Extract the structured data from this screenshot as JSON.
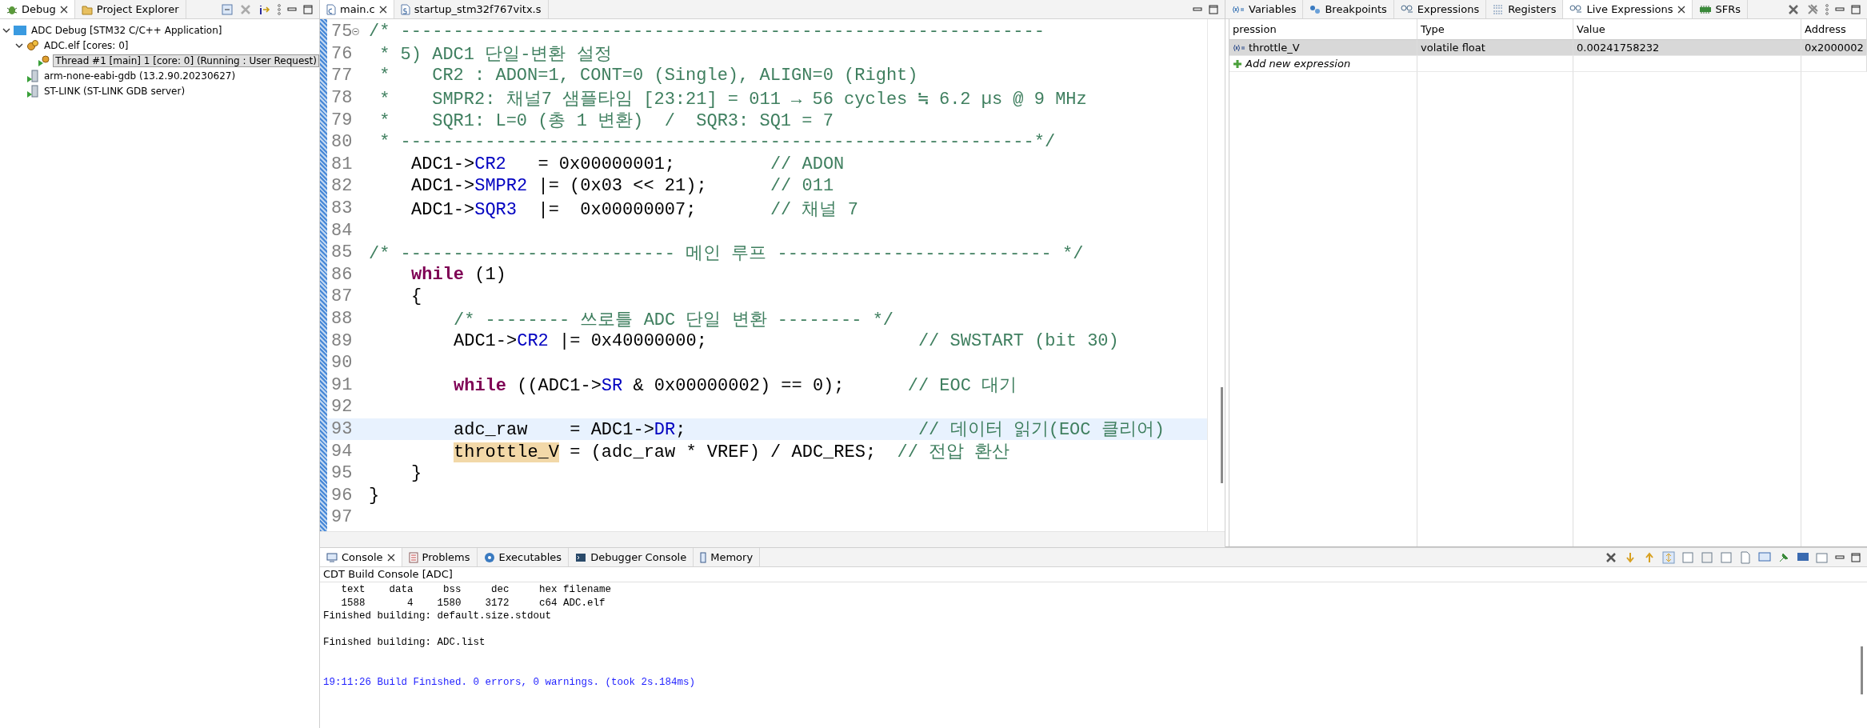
{
  "debug_view": {
    "tabs": [
      {
        "label": "Debug",
        "selected": true,
        "kind": "debug"
      },
      {
        "label": "Project Explorer",
        "selected": false,
        "kind": "project"
      }
    ],
    "tree": [
      {
        "label": "ADC Debug [STM32 C/C++ Application]",
        "kind": "launch",
        "selected": false,
        "expanded": true,
        "children": [
          {
            "label": "ADC.elf [cores: 0]",
            "kind": "process",
            "selected": false,
            "expanded": true,
            "children": [
              {
                "label": "Thread #1 [main] 1 [core: 0] (Running : User Request)",
                "kind": "thread",
                "selected": true
              }
            ]
          },
          {
            "label": "arm-none-eabi-gdb (13.2.90.20230627)",
            "kind": "server",
            "selected": false
          },
          {
            "label": "ST-LINK (ST-LINK GDB server)",
            "kind": "server",
            "selected": false
          }
        ]
      }
    ]
  },
  "editor": {
    "tabs": [
      {
        "label": "main.c",
        "selected": true,
        "kind": "c"
      },
      {
        "label": "startup_stm32f767vitx.s",
        "selected": false,
        "kind": "s"
      }
    ],
    "lines": [
      {
        "number": "75",
        "folded_marker": true,
        "current": false,
        "tokens": [
          {
            "kind": "comment",
            "text": "/* -------------------------------------------------------------"
          }
        ]
      },
      {
        "number": "76",
        "current": false,
        "tokens": [
          {
            "kind": "comment",
            "text": " * 5) ADC1 단일-변환 설정"
          }
        ]
      },
      {
        "number": "77",
        "current": false,
        "tokens": [
          {
            "kind": "comment",
            "text": " *    CR2 : ADON=1, CONT=0 (Single), ALIGN=0 (Right)"
          }
        ]
      },
      {
        "number": "78",
        "current": false,
        "tokens": [
          {
            "kind": "comment",
            "text": " *    SMPR2: 채널7 샘플타임 [23:21] = 011 → 56 cycles ≒ 6.2 µs @ 9 MHz"
          }
        ]
      },
      {
        "number": "79",
        "current": false,
        "tokens": [
          {
            "kind": "comment",
            "text": " *    SQR1: L=0 (총 1 변환)  /  SQR3: SQ1 = 7"
          }
        ]
      },
      {
        "number": "80",
        "current": false,
        "tokens": [
          {
            "kind": "comment",
            "text": " * ------------------------------------------------------------*/"
          }
        ]
      },
      {
        "number": "81",
        "current": false,
        "kind": "nested",
        "tokens": [
          {
            "kind": "plain",
            "text": "ADC1->"
          },
          {
            "kind": "field",
            "text": "CR2"
          },
          {
            "kind": "plain",
            "text": "   = 0x00000001;         "
          },
          {
            "kind": "comment",
            "text": "// ADON"
          }
        ]
      },
      {
        "number": "82",
        "current": false,
        "kind": "nested",
        "tokens": [
          {
            "kind": "plain",
            "text": "ADC1->"
          },
          {
            "kind": "field",
            "text": "SMPR2"
          },
          {
            "kind": "plain",
            "text": " |= (0x03 << 21);      "
          },
          {
            "kind": "comment",
            "text": "// 011"
          }
        ]
      },
      {
        "number": "83",
        "current": false,
        "kind": "nested",
        "tokens": [
          {
            "kind": "plain",
            "text": "ADC1->"
          },
          {
            "kind": "field",
            "text": "SQR3"
          },
          {
            "kind": "plain",
            "text": "  |=  0x00000007;       "
          },
          {
            "kind": "comment",
            "text": "// 채널 7"
          }
        ]
      },
      {
        "number": "84",
        "current": false
      },
      {
        "number": "85",
        "current": false,
        "tokens": [
          {
            "kind": "comment",
            "text": "/* -------------------------- 메인 루프 -------------------------- */"
          }
        ]
      },
      {
        "number": "86",
        "current": false,
        "kind": "nested",
        "tokens": [
          {
            "kind": "keyword",
            "text": "while"
          },
          {
            "kind": "plain",
            "text": " (1)"
          }
        ]
      },
      {
        "number": "87",
        "current": false,
        "kind": "nested",
        "tokens": [
          {
            "kind": "plain",
            "text": "{"
          }
        ]
      },
      {
        "number": "88",
        "current": false,
        "kind": "deep",
        "tokens": [
          {
            "kind": "comment",
            "text": "/* -------- 쓰로틀 ADC 단일 변환 -------- */"
          }
        ]
      },
      {
        "number": "89",
        "current": false,
        "kind": "deep",
        "tokens": [
          {
            "kind": "plain",
            "text": "ADC1->"
          },
          {
            "kind": "field",
            "text": "CR2"
          },
          {
            "kind": "plain",
            "text": " |= 0x40000000;                    "
          },
          {
            "kind": "comment",
            "text": "// SWSTART (bit 30)"
          }
        ]
      },
      {
        "number": "90",
        "current": false
      },
      {
        "number": "91",
        "current": false,
        "kind": "deep",
        "tokens": [
          {
            "kind": "keyword",
            "text": "while"
          },
          {
            "kind": "plain",
            "text": " ((ADC1->"
          },
          {
            "kind": "field",
            "text": "SR"
          },
          {
            "kind": "plain",
            "text": " & 0x00000002) == 0);      "
          },
          {
            "kind": "comment",
            "text": "// EOC 대기"
          }
        ]
      },
      {
        "number": "92",
        "current": false
      },
      {
        "number": "93",
        "current": true,
        "kind": "deep",
        "tokens": [
          {
            "kind": "plain",
            "text": "adc_raw    = ADC1->"
          },
          {
            "kind": "field",
            "text": "DR"
          },
          {
            "kind": "plain",
            "text": ";                      "
          },
          {
            "kind": "comment",
            "text": "// 데이터 읽기(EOC 클리어)"
          }
        ]
      },
      {
        "number": "94",
        "current": false,
        "kind": "deep",
        "tokens": [
          {
            "kind": "occurrence",
            "text": "throttle_V"
          },
          {
            "kind": "plain",
            "text": " = (adc_raw * VREF) / ADC_RES;  "
          },
          {
            "kind": "comment",
            "text": "// 전압 환산"
          }
        ]
      },
      {
        "number": "95",
        "current": false,
        "kind": "nested",
        "tokens": [
          {
            "kind": "plain",
            "text": "}"
          }
        ]
      },
      {
        "number": "96",
        "current": false,
        "tokens": [
          {
            "kind": "plain",
            "text": "}"
          }
        ]
      },
      {
        "number": "97",
        "current": false
      }
    ]
  },
  "expressions_view": {
    "tabs": [
      {
        "label": "Variables",
        "selected": false,
        "kind": "variables"
      },
      {
        "label": "Breakpoints",
        "selected": false,
        "kind": "breakpoints"
      },
      {
        "label": "Expressions",
        "selected": false,
        "kind": "expressions"
      },
      {
        "label": "Registers",
        "selected": false,
        "kind": "registers"
      },
      {
        "label": "Live Expressions",
        "selected": true,
        "kind": "expressions"
      },
      {
        "label": "SFRs",
        "selected": false,
        "kind": "sfrs"
      }
    ],
    "columns": [
      "pression",
      "Type",
      "Value",
      "Address"
    ],
    "rows": [
      {
        "cells": [
          "throttle_V",
          "volatile float",
          "0.00241758232",
          "0x2000002"
        ],
        "selected": true
      }
    ],
    "add_row": "Add new expression"
  },
  "console_view": {
    "tabs": [
      {
        "label": "Console",
        "selected": true,
        "kind": "console"
      },
      {
        "label": "Problems",
        "selected": false,
        "kind": "problems"
      },
      {
        "label": "Executables",
        "selected": false,
        "kind": "executables"
      },
      {
        "label": "Debugger Console",
        "selected": false,
        "kind": "debugger"
      },
      {
        "label": "Memory",
        "selected": false,
        "kind": "memory"
      }
    ],
    "title": "CDT Build Console [ADC]",
    "lines": [
      {
        "kind": "plain",
        "text": "   text\t   data\t    bss\t    dec\t    hex\tfilename"
      },
      {
        "kind": "plain",
        "text": "   1588\t      4\t   1580\t   3172\t    c64\tADC.elf"
      },
      {
        "kind": "plain",
        "text": "Finished building: default.size.stdout"
      },
      {
        "kind": "blank"
      },
      {
        "kind": "plain",
        "text": "Finished building: ADC.list"
      },
      {
        "kind": "blank"
      },
      {
        "kind": "blank"
      },
      {
        "kind": "info",
        "text": "19:11:26 Build Finished. 0 errors, 0 warnings. (took 2s.184ms)"
      }
    ]
  }
}
